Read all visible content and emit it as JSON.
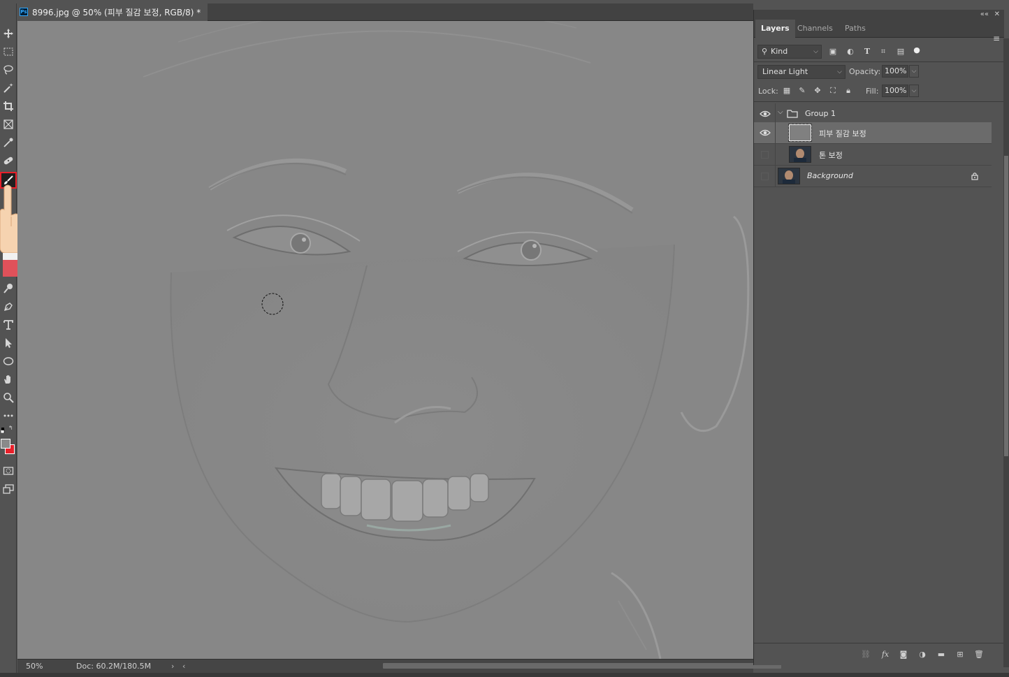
{
  "document": {
    "tab_title": "8996.jpg @ 50% (피부 질감 보정, RGB/8) *",
    "ps_badge": "Ps"
  },
  "toolbar": {
    "tools": [
      "move-tool",
      "marquee-tool",
      "lasso-tool",
      "magic-wand-tool",
      "crop-tool",
      "frame-tool",
      "eyedropper-tool",
      "healing-brush-tool",
      "brush-tool",
      "dodge-tool",
      "pen-tool",
      "type-tool",
      "path-selection-tool",
      "ellipse-tool",
      "hand-tool",
      "zoom-tool",
      "more-tools"
    ],
    "active_tool": "brush-tool",
    "foreground_color": "#8a8a8a",
    "background_color": "#e8202a"
  },
  "status": {
    "zoom": "50%",
    "doc_size": "Doc: 60.2M/180.5M",
    "arrow": "›",
    "left_arrow": "‹"
  },
  "layers_panel": {
    "window_controls": {
      "collapse": "««",
      "close": "✕"
    },
    "tabs": [
      "Layers",
      "Channels",
      "Paths"
    ],
    "active_tab": "Layers",
    "filter": {
      "label": "Kind"
    },
    "blend_mode": "Linear Light",
    "opacity_label": "Opacity:",
    "opacity_value": "100%",
    "lock_label": "Lock:",
    "fill_label": "Fill:",
    "fill_value": "100%",
    "layers": [
      {
        "name": "Group 1",
        "type": "group",
        "visible": true,
        "selected": false
      },
      {
        "name": "피부 질감 보정",
        "type": "layer",
        "visible": true,
        "selected": true
      },
      {
        "name": "톤 보정",
        "type": "layer",
        "visible": false,
        "selected": false
      },
      {
        "name": "Background",
        "type": "background",
        "visible": false,
        "selected": false,
        "locked": true
      }
    ]
  },
  "colors": {
    "accent_red": "#e8202a",
    "panel_bg": "#535353",
    "canvas_gray": "#888888",
    "selected_layer": "#6b6b6b"
  }
}
